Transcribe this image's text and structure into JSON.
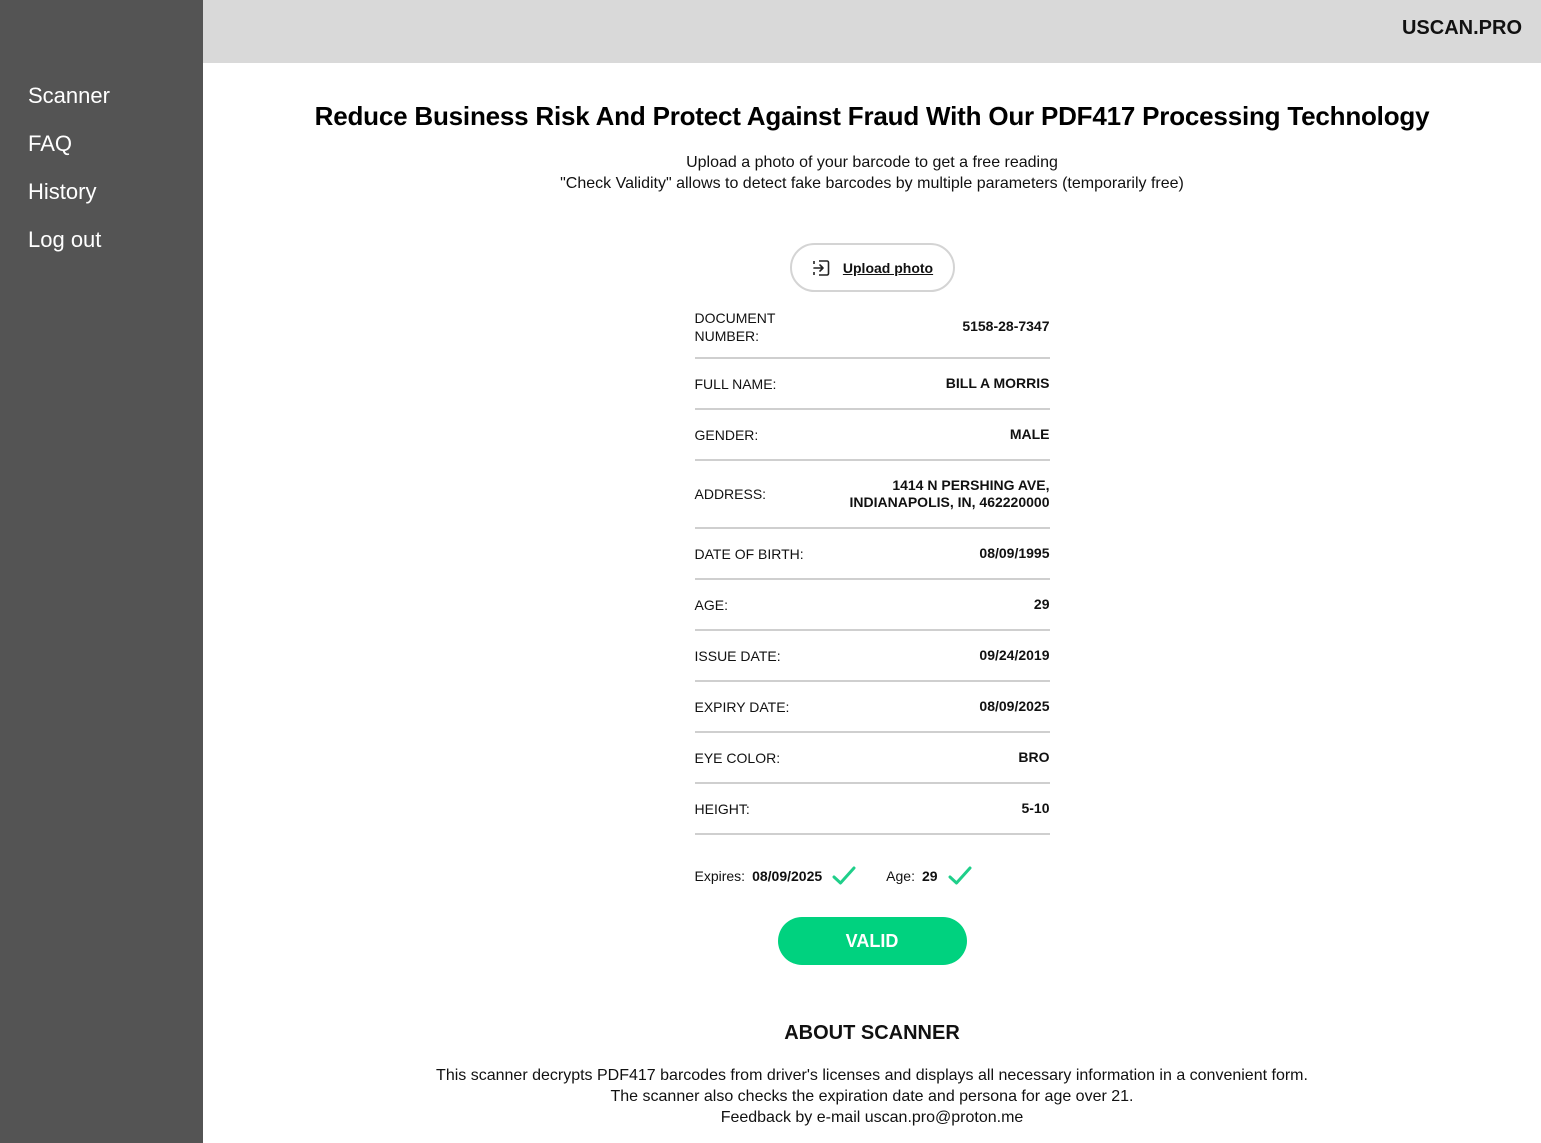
{
  "sidebar": {
    "items": [
      {
        "label": "Scanner"
      },
      {
        "label": "FAQ"
      },
      {
        "label": "History"
      },
      {
        "label": "Log out"
      }
    ]
  },
  "topbar": {
    "brand": "USCAN.PRO"
  },
  "main": {
    "title": "Reduce Business Risk And Protect Against Fraud With Our PDF417 Processing Technology",
    "subtitle_line1": "Upload a photo of your barcode to get a free reading",
    "subtitle_line2": "\"Check Validity\" allows to detect fake barcodes by multiple parameters (temporarily free)",
    "upload": {
      "label": "Upload photo",
      "icon": "upload-icon"
    },
    "fields": [
      {
        "key": "DOCUMENT NUMBER:",
        "value": "5158-28-7347"
      },
      {
        "key": "FULL NAME:",
        "value": "BILL A MORRIS"
      },
      {
        "key": "GENDER:",
        "value": "MALE"
      },
      {
        "key": "ADDRESS:",
        "value": "1414 N PERSHING AVE, INDIANAPOLIS, IN, 462220000"
      },
      {
        "key": "DATE OF BIRTH:",
        "value": "08/09/1995"
      },
      {
        "key": "AGE:",
        "value": "29"
      },
      {
        "key": "ISSUE DATE:",
        "value": "09/24/2019"
      },
      {
        "key": "EXPIRY DATE:",
        "value": "08/09/2025"
      },
      {
        "key": "EYE COLOR:",
        "value": "BRO"
      },
      {
        "key": "HEIGHT:",
        "value": "5-10"
      }
    ],
    "checks": {
      "expires": {
        "label": "Expires:",
        "value": "08/09/2025",
        "icon": "check-icon"
      },
      "age": {
        "label": "Age:",
        "value": "29",
        "icon": "check-icon"
      }
    },
    "valid_label": "VALID",
    "accent_color": "#00d27f",
    "about": {
      "title": "ABOUT SCANNER",
      "line1": "This scanner decrypts PDF417 barcodes from driver's licenses and displays all necessary information in a convenient form.",
      "line2": "The scanner also checks the expiration date and persona for age over 21.",
      "line3": "Feedback by e-mail uscan.pro@proton.me"
    }
  }
}
